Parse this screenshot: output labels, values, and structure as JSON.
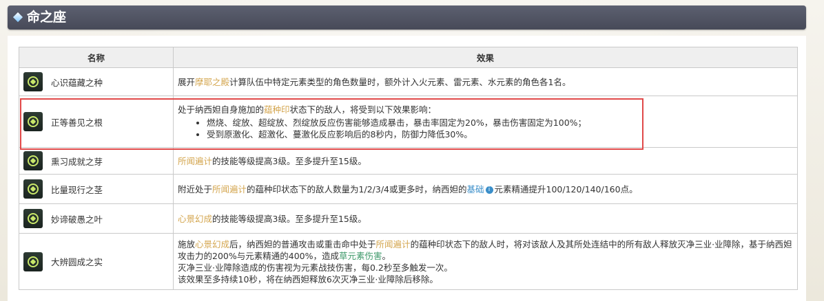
{
  "header": {
    "title": "命之座"
  },
  "table": {
    "col_name": "名称",
    "col_effect": "效果"
  },
  "rows": [
    {
      "name": "心识蕴藏之种",
      "e": [
        "展开",
        "摩耶之殿",
        "计算队伍中特定元素类型的角色数量时，额外计入火元素、雷元素、水元素的角色各1名。"
      ]
    },
    {
      "name": "正等善见之根",
      "e": [
        "处于纳西妲自身施加的",
        "蕴种印",
        "状态下的敌人，将受到以下效果影响："
      ],
      "bullets": [
        "燃烧、绽放、超绽放、烈绽放反应伤害能够造成暴击，暴击率固定为20%，暴击伤害固定为100%；",
        "受到原激化、超激化、蔓激化反应影响后的8秒内，防御力降低30%。"
      ]
    },
    {
      "name": "熏习成就之芽",
      "e": [
        "所闻遍计",
        "的技能等级提高3级。至多提升至15级。"
      ]
    },
    {
      "name": "比量现行之茎",
      "e": [
        "附近处于",
        "所闻遍计",
        "的蕴种印状态下的敌人数量为1/2/3/4或更多时，纳西妲的",
        "基础",
        "元素精通提升100/120/140/160点。"
      ],
      "info_glyph": "i"
    },
    {
      "name": "妙谛破愚之叶",
      "e": [
        "心景幻成",
        "的技能等级提高3级。至多提升至15级。"
      ]
    },
    {
      "name": "大辨圆成之实",
      "e": [
        "施放",
        "心景幻成",
        "后，纳西妲的普通攻击或重击命中处于",
        "所闻遍计",
        "的蕴种印状态下的敌人时，将对该敌人及其所处连结中的所有敌人释放灭净三业·业障除，基于纳西妲攻击力的200%与元素精通的400%，造成",
        "草元素伤害",
        "。"
      ],
      "lines": [
        "灭净三业·业障除造成的伤害视为元素战技伤害，每0.2秒至多触发一次。",
        "该效果至多持续10秒，将在纳西妲释放6次灭净三业·业障除后移除。"
      ]
    }
  ],
  "colors": {
    "highlight_gold": "#d4a64f",
    "highlight_blue": "#3a8ec9",
    "highlight_green": "#3f9a6b",
    "outline_red": "#e04848"
  },
  "icons": [
    "constellation-icon"
  ]
}
